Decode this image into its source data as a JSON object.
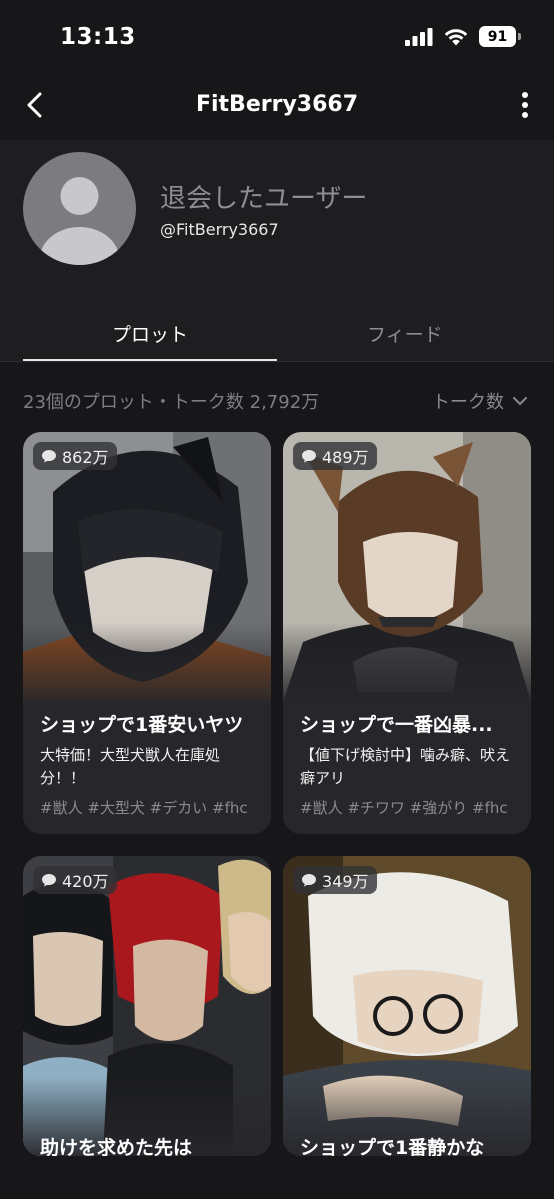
{
  "status": {
    "time": "13:13",
    "battery": "91"
  },
  "nav": {
    "title": "FitBerry3667"
  },
  "profile": {
    "name": "退会したユーザー",
    "handle": "@FitBerry3667"
  },
  "tabs": [
    {
      "label": "プロット"
    },
    {
      "label": "フィード"
    }
  ],
  "summary": "23個のプロット・トーク数 2,792万",
  "sort_label": "トーク数",
  "cards": [
    {
      "count": "862万",
      "title": "ショップで1番安いヤツ",
      "desc": "大特価！大型犬獣人在庫処分！！",
      "tags": "#獣人 #大型犬 #デカい #fhc"
    },
    {
      "count": "489万",
      "title": "ショップで一番凶暴...",
      "desc": "【値下げ検討中】噛み癖、吠え癖アリ",
      "tags": "#獣人 #チワワ #強がり #fhc"
    },
    {
      "count": "420万",
      "title": "助けを求めた先は",
      "desc": "",
      "tags": ""
    },
    {
      "count": "349万",
      "title": "ショップで1番静かな",
      "desc": "",
      "tags": ""
    }
  ],
  "colors": {
    "background": "#171719",
    "card": "#27272b",
    "accent": "#ffffff",
    "muted": "#8e8e92"
  }
}
